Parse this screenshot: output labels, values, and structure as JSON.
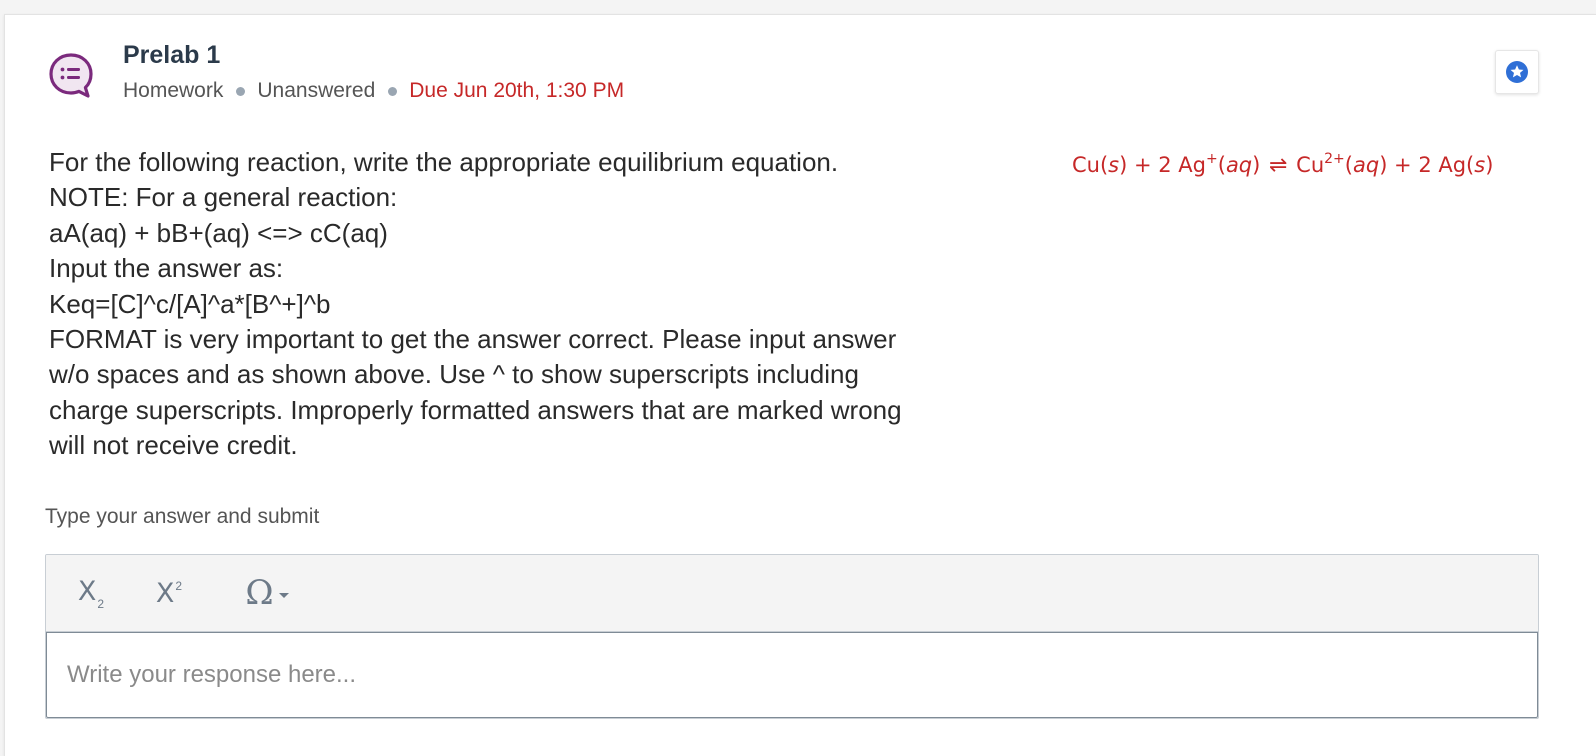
{
  "question": {
    "title": "Prelab 1",
    "type": "Homework",
    "status": "Unanswered",
    "due": "Due Jun 20th, 1:30 PM",
    "icon": "question-bubble-icon",
    "accent_color": "#7b2a7d",
    "due_color": "#c62828"
  },
  "prompt": {
    "lines": [
      "For the following reaction, write the appropriate equilibrium equation.",
      "NOTE: For a general reaction:",
      "aA(aq) + bB+(aq) <=> cC(aq)",
      "Input the answer as:",
      "Keq=[C]^c/[A]^a*[B^+]^b",
      "FORMAT is very important to get the answer correct. Please input answer",
      "w/o spaces and as shown above. Use ^ to show superscripts including",
      "charge superscripts. Improperly formatted answers that are marked wrong",
      "will not receive credit."
    ]
  },
  "equation": {
    "cu": "Cu(",
    "s1": "s",
    "close1": ") + 2 Ag",
    "ag_charge": "+",
    "open_aq1": "(",
    "aq1": "aq",
    "close_aq1": ")",
    "arrows": "⇌",
    "cu2": "Cu",
    "cu2_charge": "2+",
    "open_aq2": "(",
    "aq2": "aq",
    "close_aq2": ") + 2 Ag(",
    "s2": "s",
    "end": ")"
  },
  "answer": {
    "label": "Type your answer and submit",
    "placeholder": "Write your response here...",
    "toolbar": {
      "subscript": {
        "letter": "X",
        "mark": "2",
        "icon": "subscript-icon"
      },
      "superscript": {
        "letter": "X",
        "mark": "2",
        "icon": "superscript-icon"
      },
      "symbol": {
        "glyph": "Ω",
        "icon": "omega-icon"
      }
    }
  },
  "star_button": {
    "icon": "star-icon",
    "color": "#2f6fd6"
  }
}
